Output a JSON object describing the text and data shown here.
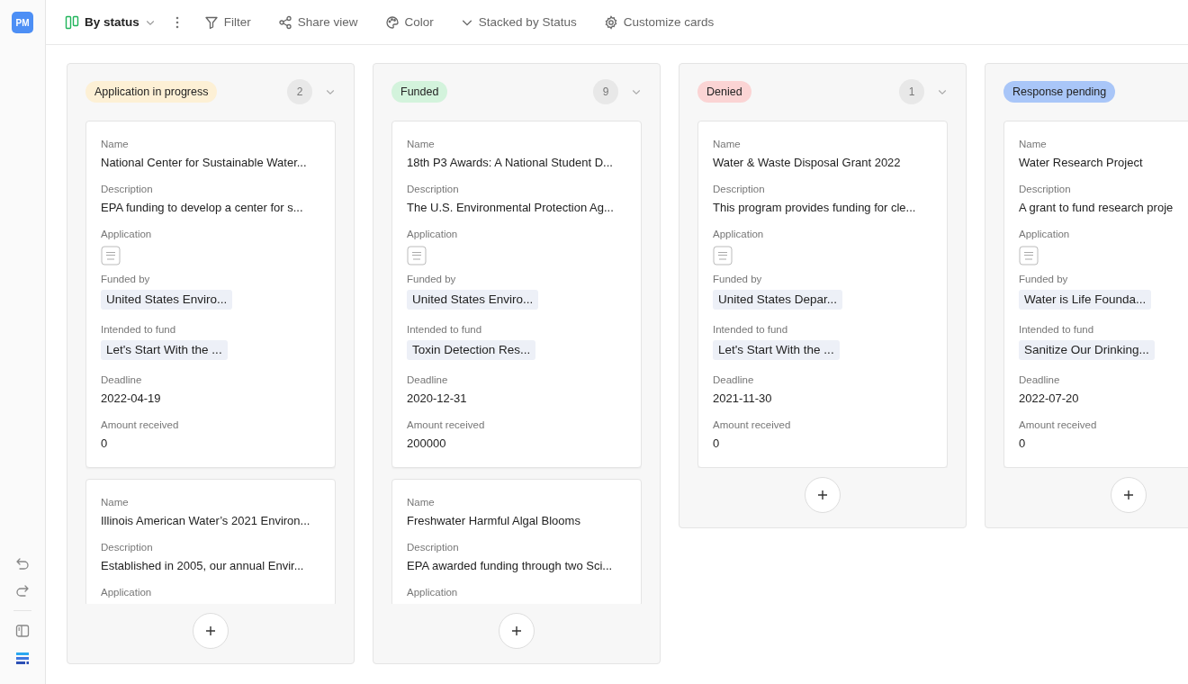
{
  "sidebar": {
    "avatar": "PM"
  },
  "toolbar": {
    "view": "By status",
    "items": [
      {
        "kind": "filter",
        "label": "Filter"
      },
      {
        "kind": "share",
        "label": "Share view"
      },
      {
        "kind": "color",
        "label": "Color"
      },
      {
        "kind": "stack",
        "label": "Stacked by Status"
      },
      {
        "kind": "customize",
        "label": "Customize cards"
      }
    ]
  },
  "columns": [
    {
      "status": "Application in progress",
      "color": "#fdf0d5",
      "count": "2",
      "clipped": true,
      "cards": [
        {
          "fields": [
            {
              "label": "Name",
              "kind": "text",
              "value": "National Center for Sustainable Water..."
            },
            {
              "label": "Description",
              "kind": "text",
              "value": "EPA funding to develop a center for s..."
            },
            {
              "label": "Application",
              "kind": "pdf"
            },
            {
              "label": "Funded by",
              "kind": "chip",
              "value": "United States Enviro..."
            },
            {
              "label": "Intended to fund",
              "kind": "chip",
              "value": "Let's Start With the ..."
            },
            {
              "label": "Deadline",
              "kind": "text",
              "value": "2022-04-19"
            },
            {
              "label": "Amount received",
              "kind": "text",
              "value": "0"
            }
          ]
        },
        {
          "fields": [
            {
              "label": "Name",
              "kind": "text",
              "value": "Illinois American Water’s 2021 Environ..."
            },
            {
              "label": "Description",
              "kind": "text",
              "value": "Established in 2005, our annual Envir..."
            },
            {
              "label": "Application",
              "kind": "label"
            }
          ]
        }
      ]
    },
    {
      "status": "Funded",
      "color": "#d3f3dc",
      "count": "9",
      "clipped": true,
      "cards": [
        {
          "fields": [
            {
              "label": "Name",
              "kind": "text",
              "value": "18th P3 Awards: A National Student D..."
            },
            {
              "label": "Description",
              "kind": "text",
              "value": "The U.S. Environmental Protection Ag..."
            },
            {
              "label": "Application",
              "kind": "pdf"
            },
            {
              "label": "Funded by",
              "kind": "chip",
              "value": "United States Enviro..."
            },
            {
              "label": "Intended to fund",
              "kind": "chip",
              "value": "Toxin Detection Res..."
            },
            {
              "label": "Deadline",
              "kind": "text",
              "value": "2020-12-31"
            },
            {
              "label": "Amount received",
              "kind": "text",
              "value": "200000"
            }
          ]
        },
        {
          "fields": [
            {
              "label": "Name",
              "kind": "text",
              "value": "Freshwater Harmful Algal Blooms"
            },
            {
              "label": "Description",
              "kind": "text",
              "value": "EPA awarded funding through two Sci..."
            },
            {
              "label": "Application",
              "kind": "label"
            }
          ]
        }
      ]
    },
    {
      "status": "Denied",
      "color": "#fbd4d4",
      "count": "1",
      "clipped": false,
      "cards": [
        {
          "fields": [
            {
              "label": "Name",
              "kind": "text",
              "value": "Water & Waste Disposal Grant 2022"
            },
            {
              "label": "Description",
              "kind": "text",
              "value": "This program provides funding for cle..."
            },
            {
              "label": "Application",
              "kind": "pdf"
            },
            {
              "label": "Funded by",
              "kind": "chip",
              "value": "United States Depar..."
            },
            {
              "label": "Intended to fund",
              "kind": "chip",
              "value": "Let's Start With the ..."
            },
            {
              "label": "Deadline",
              "kind": "text",
              "value": "2021-11-30"
            },
            {
              "label": "Amount received",
              "kind": "text",
              "value": "0"
            }
          ]
        }
      ]
    },
    {
      "status": "Response pending",
      "color": "#a9c6f8",
      "clipped": false,
      "cards": [
        {
          "fields": [
            {
              "label": "Name",
              "kind": "text",
              "value": "Water Research Project"
            },
            {
              "label": "Description",
              "kind": "text",
              "value": "A grant to fund research proje"
            },
            {
              "label": "Application",
              "kind": "pdf"
            },
            {
              "label": "Funded by",
              "kind": "chip",
              "value": "Water is Life Founda..."
            },
            {
              "label": "Intended to fund",
              "kind": "chip",
              "value": "Sanitize Our Drinking..."
            },
            {
              "label": "Deadline",
              "kind": "text",
              "value": "2022-07-20"
            },
            {
              "label": "Amount received",
              "kind": "text",
              "value": "0"
            }
          ]
        }
      ]
    }
  ]
}
